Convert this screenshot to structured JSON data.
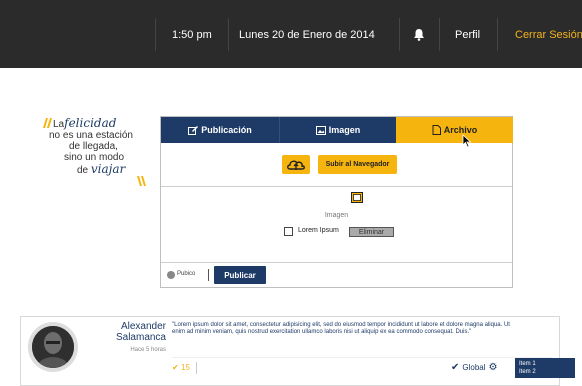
{
  "topbar": {
    "time": "1:50 pm",
    "date": "Lunes 20 de Enero de 2014",
    "profile": "Perfil",
    "logout": "Cerrar Sesión",
    "icon": "bell-icon"
  },
  "quote": {
    "l1_fancy": "felicidad",
    "l1_prefix": "La",
    "l2": "no es una estación",
    "l3": "de llegada,",
    "l4": "sino un modo",
    "l5_prefix": "de",
    "l5_fancy": "viajar"
  },
  "composer": {
    "tabs": [
      {
        "label": "Publicación",
        "icon": "edit-icon"
      },
      {
        "label": "Imagen",
        "icon": "image-icon"
      },
      {
        "label": "Archivo",
        "icon": "file-icon",
        "active": true
      }
    ],
    "upload_label": "Subir al Navegador",
    "image_label": "Imagen",
    "checkbox_label": "Lorem Ipsum",
    "delete_label": "Eliminar",
    "visibility": "Pubico",
    "publish_label": "Publicar"
  },
  "post": {
    "author": "Alexander Salamanca",
    "time_ago": "Hace 5 horas",
    "body": "\"Lorem ipsum dolor sit amet, consectetur adipisicing elit, sed do eiusmod tempor incididunt ut labore et dolore magna aliqua. Ut enim ad minim veniam, quis nostrud exercitation ullamco laboris nisi ut aliquip ex ea commodo consequat. Duis.\"",
    "likes": "15",
    "scope": "Global",
    "dropdown_items": [
      "Item 1",
      "Item 2"
    ]
  },
  "colors": {
    "navy": "#1e3b68",
    "accent": "#f6b50e",
    "topbar": "#2b2b2b"
  }
}
